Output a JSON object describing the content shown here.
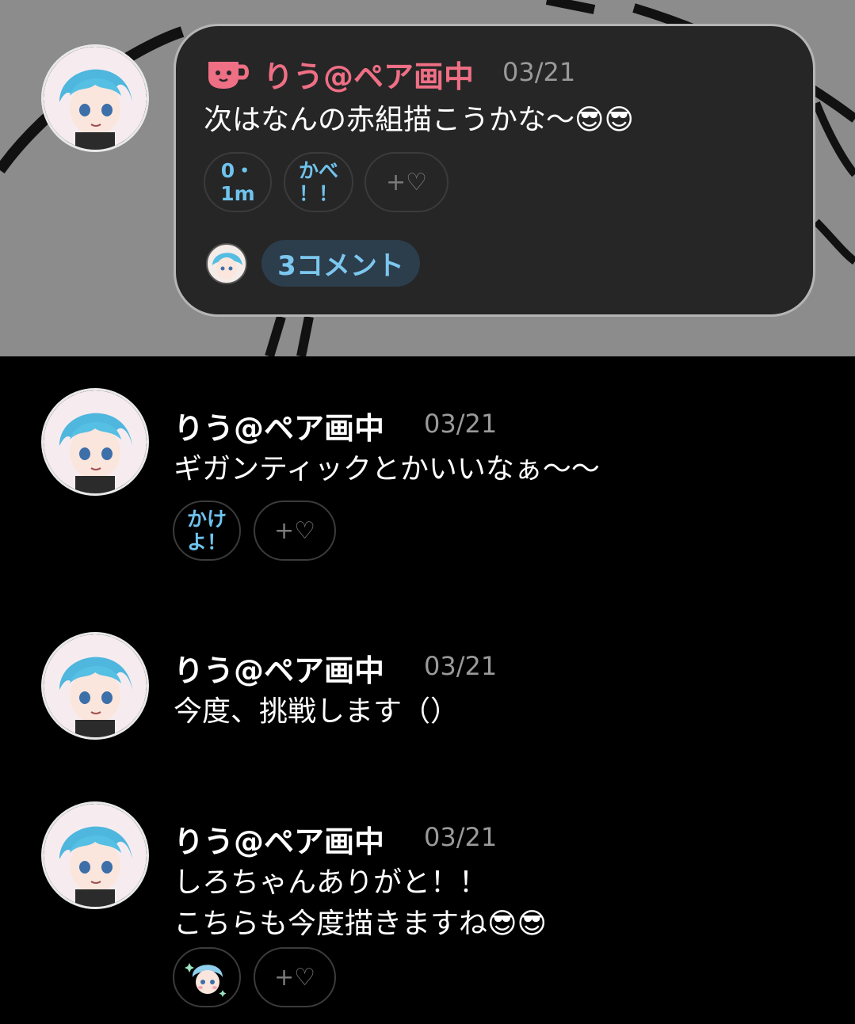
{
  "pinned_post": {
    "author": "りう@ペア画中",
    "date": "03/21",
    "text": "次はなんの赤組描こうかな〜😎😎",
    "reactions": [
      {
        "label": "0・\n1m"
      },
      {
        "label": "かべ\n！！"
      }
    ],
    "add_reaction_label": "+♡",
    "comments_label": "3コメント",
    "accent_color": "#ef6f85"
  },
  "comments": [
    {
      "author": "りう@ペア画中",
      "date": "03/21",
      "text": "ギガンティックとかいいなぁ〜〜",
      "reactions": [
        {
          "label": "かけ\nよ！"
        }
      ],
      "add_reaction_label": "+♡"
    },
    {
      "author": "りう@ペア画中",
      "date": "03/21",
      "text": "今度、挑戦します（）"
    },
    {
      "author": "りう@ペア画中",
      "date": "03/21",
      "text_line1": "しろちゃんありがと！！",
      "text_line2": "こちらも今度描きますね😎😎",
      "add_reaction_label": "+♡"
    }
  ],
  "icons": {
    "author_badge": "coffee-cup-icon",
    "add_reaction": "heart-plus-icon"
  },
  "colors": {
    "reaction_text": "#6fc3ee",
    "comment_pill_bg": "#2c3d4c"
  }
}
